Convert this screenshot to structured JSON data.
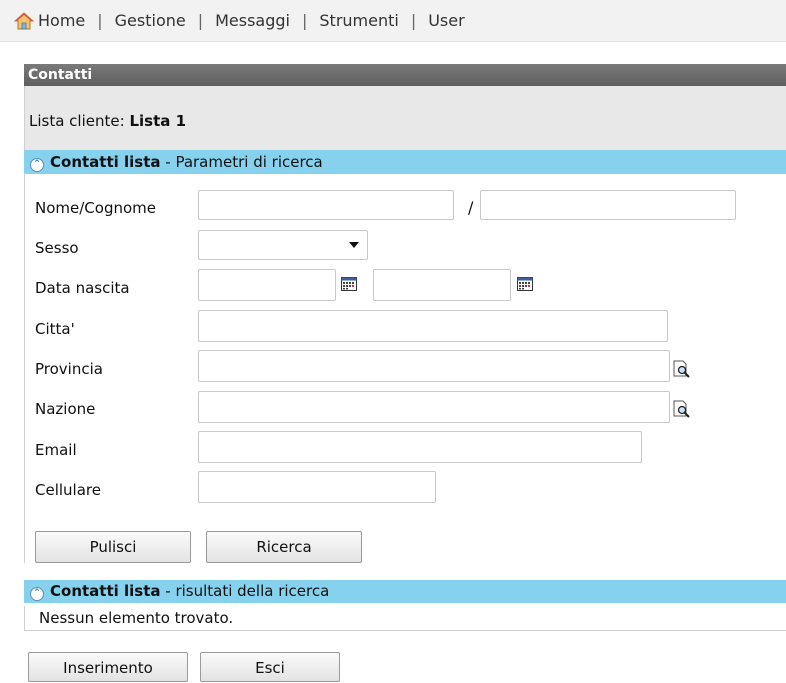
{
  "nav": {
    "items": [
      "Home",
      "Gestione",
      "Messaggi",
      "Strumenti",
      "User"
    ],
    "separator": "|"
  },
  "panel": {
    "title": "Contatti",
    "list_label": "Lista cliente:",
    "list_name": "Lista 1"
  },
  "search_section": {
    "bold": "Contatti lista",
    "rest": " - Parametri di ricerca"
  },
  "fields": {
    "nome_cognome": {
      "label": "Nome/Cognome",
      "value1": "",
      "value2": "",
      "separator": "/"
    },
    "sesso": {
      "label": "Sesso",
      "selected": ""
    },
    "data_nascita": {
      "label": "Data nascita",
      "from": "",
      "to": ""
    },
    "citta": {
      "label": "Citta'",
      "value": ""
    },
    "provincia": {
      "label": "Provincia",
      "value": ""
    },
    "nazione": {
      "label": "Nazione",
      "value": ""
    },
    "email": {
      "label": "Email",
      "value": ""
    },
    "cellulare": {
      "label": "Cellulare",
      "value": ""
    }
  },
  "buttons": {
    "pulisci": "Pulisci",
    "ricerca": "Ricerca",
    "inserimento": "Inserimento",
    "esci": "Esci"
  },
  "results_section": {
    "bold": "Contatti lista",
    "rest": " - risultati della ricerca",
    "empty_message": "Nessun elemento trovato."
  },
  "icons": {
    "home": "home-icon",
    "collapse": "collapse-up-icon",
    "calendar": "calendar-icon",
    "lookup": "lookup-magnifier-icon",
    "dropdown": "chevron-down-icon"
  },
  "colors": {
    "section_bar": "#86d1ee",
    "title_bar": "#6a6a6a",
    "info_bar": "#e8e8e8"
  }
}
